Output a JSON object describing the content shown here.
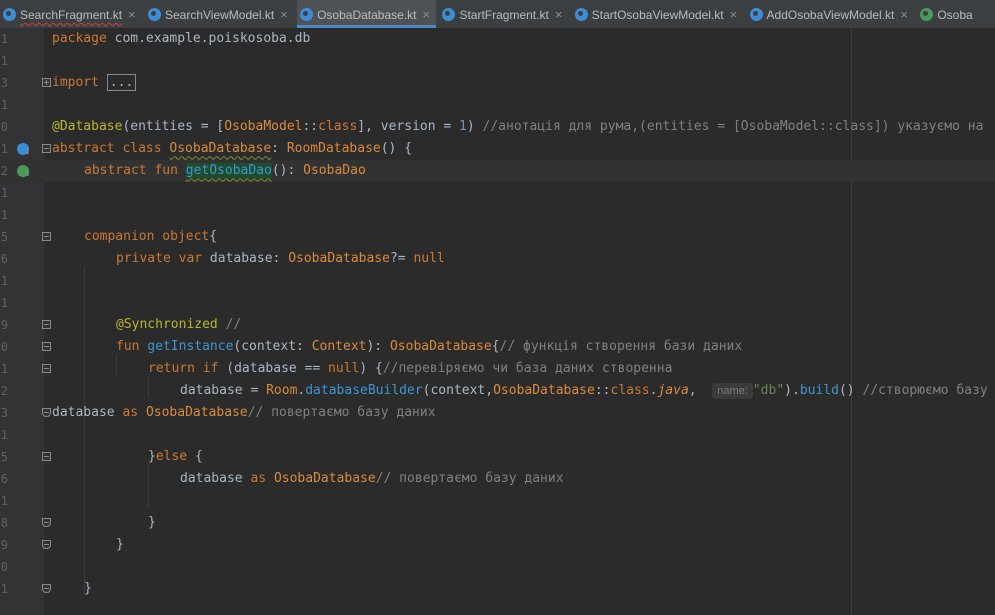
{
  "tabs": [
    {
      "label": "SearchFragment.kt",
      "close": "×",
      "active": false,
      "error": true
    },
    {
      "label": "SearchViewModel.kt",
      "close": "×",
      "active": false,
      "error": false
    },
    {
      "label": "OsobaDatabase.kt",
      "close": "×",
      "active": true,
      "error": false
    },
    {
      "label": "StartFragment.kt",
      "close": "×",
      "active": false,
      "error": false
    },
    {
      "label": "StartOsobaViewModel.kt",
      "close": "×",
      "active": false,
      "error": false
    },
    {
      "label": "AddOsobaViewModel.kt",
      "close": "×",
      "active": false,
      "error": false
    },
    {
      "label": "Osoba",
      "close": "",
      "active": false,
      "error": false
    }
  ],
  "line_numbers": [
    "1",
    "1",
    "3",
    "1",
    "0",
    "1",
    "2",
    "1",
    "1",
    "5",
    "6",
    "1",
    "1",
    "9",
    "0",
    "1",
    "2",
    "3",
    "1",
    "5",
    "6",
    "1",
    "8",
    "9",
    "0",
    "1"
  ],
  "code": {
    "l1": {
      "kw": "package",
      "rest": " com.example.poiskosoba.db"
    },
    "l3": {
      "kw": "import",
      "collapsed": "..."
    },
    "l5": {
      "ann": "@Database",
      "p1": "(entities = [",
      "t1": "OsobaModel",
      "p2": "::",
      "k1": "class",
      "p3": "], version = ",
      "num": "1",
      "p4": ") ",
      "comment": "//анотація для рума,(entities = [OsobaModel::class]) указуємо на"
    },
    "l6": {
      "k1": "abstract class ",
      "name": "OsobaDatabase",
      "p1": ": ",
      "t1": "RoomDatabase",
      "p2": "() {"
    },
    "l7": {
      "k1": "abstract fun ",
      "fn": "getOsobaDao",
      "p1": "(): ",
      "t1": "OsobaDao"
    },
    "l10": {
      "k1": "companion object",
      "p1": "{"
    },
    "l11": {
      "k1": "private var ",
      "p1": "database: ",
      "t1": "OsobaDatabase",
      "p2": "?= ",
      "k2": "null"
    },
    "l14": {
      "ann": "@Synchronized",
      "comment": " //"
    },
    "l15": {
      "k1": "fun ",
      "fn": "getInstance",
      "p1": "(context: ",
      "t1": "Context",
      "p2": "): ",
      "t2": "OsobaDatabase",
      "p3": "{",
      "comment": "// функція створення бази даних"
    },
    "l16": {
      "k1": "return if ",
      "p1": "(database == ",
      "k2": "null",
      "p2": ") {",
      "comment": "//перевіряємо чи база даних створенна"
    },
    "l17": {
      "p1": "database = ",
      "t1": "Room",
      "p2": ".",
      "fn": "databaseBuilder",
      "p3": "(context,",
      "t2": "OsobaDatabase",
      "p4": "::",
      "k1": "class",
      "p5": ".",
      "it": "java",
      "p6": ",  ",
      "hint": "name:",
      "str": "\"db\"",
      "p7": ").",
      "fn2": "build",
      "p8": "() ",
      "comment": "//створюємо базу"
    },
    "l18": {
      "p1": "database ",
      "k1": "as ",
      "t1": "OsobaDatabase",
      "comment": "// повертаємо базу даних"
    },
    "l20": {
      "p1": "}",
      "k1": "else ",
      "p2": "{"
    },
    "l21": {
      "p1": "database ",
      "k1": "as ",
      "t1": "OsobaDatabase",
      "comment": "// повертаємо базу даних"
    },
    "l23": {
      "p1": "}"
    },
    "l24": {
      "p1": "}"
    },
    "l26": {
      "p1": "}"
    }
  }
}
